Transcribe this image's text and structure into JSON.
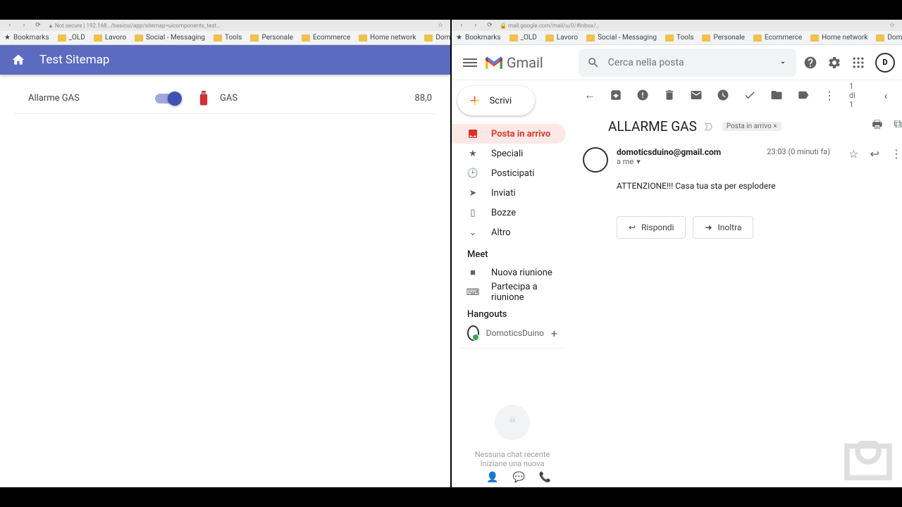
{
  "bookmarks": [
    "Bookmarks",
    "_OLD",
    "Lavoro",
    "Social - Messaging",
    "Tools",
    "Personale",
    "Ecommerce",
    "Home network",
    "Domoticsduino"
  ],
  "left": {
    "title": "Test Sitemap",
    "row1_label": "Allarme GAS",
    "row2_label": "GAS",
    "row2_value": "88,0"
  },
  "gmail": {
    "brand": "Gmail",
    "search_placeholder": "Cerca nella posta",
    "compose": "Scrivi",
    "nav": {
      "inbox": "Posta in arrivo",
      "starred": "Speciali",
      "snoozed": "Posticipati",
      "sent": "Inviati",
      "drafts": "Bozze",
      "more": "Altro"
    },
    "meet_title": "Meet",
    "meet_new": "Nuova riunione",
    "meet_join": "Partecipa a riunione",
    "hangouts_title": "Hangouts",
    "hangouts_user": "DomoticsDuino",
    "chat_empty1": "Nessuna chat recente",
    "chat_empty2": "Iniziane una nuova",
    "counter": "1 di 1",
    "email": {
      "subject": "ALLARME GAS",
      "tag": "Posta in arrivo ×",
      "from": "domoticsduino@gmail.com",
      "to": "a me",
      "time": "23:03 (0 minuti fa)",
      "body": "ATTENZIONE!!! Casa tua sta per esplodere",
      "reply": "Rispondi",
      "forward": "Inoltra"
    }
  }
}
